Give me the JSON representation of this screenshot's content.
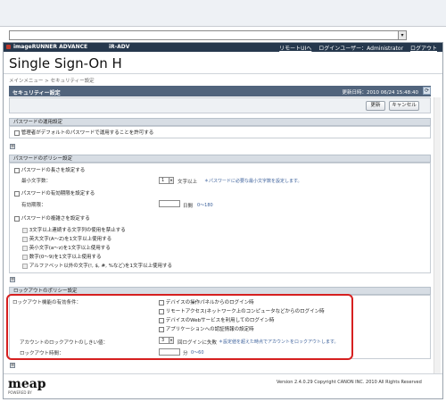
{
  "header": {
    "brand": "imageRUNNER ADVANCE",
    "model": "iR-ADV",
    "remote_ui_link": "リモートUIへ",
    "login_user_label": "ログインユーザー：Administrator",
    "logout_link": "ログアウト"
  },
  "app_title": "Single Sign-On H",
  "breadcrumb": "メインメニュー > セキュリティー設定",
  "page": {
    "title": "セキュリティー設定",
    "updated": "更新日時：2010 06/24 15:48:40",
    "refresh_button": "更新",
    "cancel_button": "キャンセル"
  },
  "password_policy_use": {
    "header": "パスワードの運用設定",
    "admin_default_label": "管理者がデフォルトのパスワードで運用することを許可する"
  },
  "password_policy": {
    "header": "パスワードのポリシー設定",
    "length_label": "パスワードの長さを設定する",
    "min_chars_label": "最小文字数：",
    "min_chars_value": "1",
    "min_chars_unit": "文字以上",
    "min_chars_hint": "＊パスワードに必要な最小文字数を設定します。",
    "expiry_label": "パスワードの有効期限を設定する",
    "expiry_period_label": "有効期限：",
    "expiry_unit": "日間",
    "expiry_range": "0～180",
    "complexity_label": "パスワードの複雑さを設定する",
    "complexity_options": [
      "3文字以上連続する文字列の使用を禁止する",
      "英大文字(A～Z)を1文字以上使用する",
      "英小文字(a～z)を1文字以上使用する",
      "数字(0～9)を1文字以上使用する",
      "アルファベット以外の文字(!, $, #, %など)を1文字以上使用する"
    ]
  },
  "lockout_policy": {
    "header": "ロックアウトのポリシー設定",
    "applied_label": "ロックアウト機能の有効条件：",
    "conditions": [
      "デバイスの操作パネルからのログイン時",
      "リモートアクセス(ネットワーク上のコンピュータなどからのログイン時",
      "デバイスのWebサービスを利用してのログイン時",
      "アプリケーションへの認証情報の設定時"
    ],
    "threshold_label": "アカウントのロックアウトのしきい値：",
    "threshold_value": "3",
    "threshold_unit": "回ログインに失敗",
    "threshold_hint": "＊設定値を超えた時点でアカウントをロックアウトします。",
    "duration_label": "ロックアウト時間：",
    "duration_unit": "分",
    "duration_range": "0～60"
  },
  "footer": {
    "logo": "meap",
    "logo_sub": "POWERED BY",
    "copyright": "Version 2.4.0.29 Copyright CANON INC. 2010 All Rights Reserved"
  },
  "colors": {
    "header_bg": "#26384d",
    "pagebar_bg": "#51647c",
    "highlight": "#d62020"
  }
}
